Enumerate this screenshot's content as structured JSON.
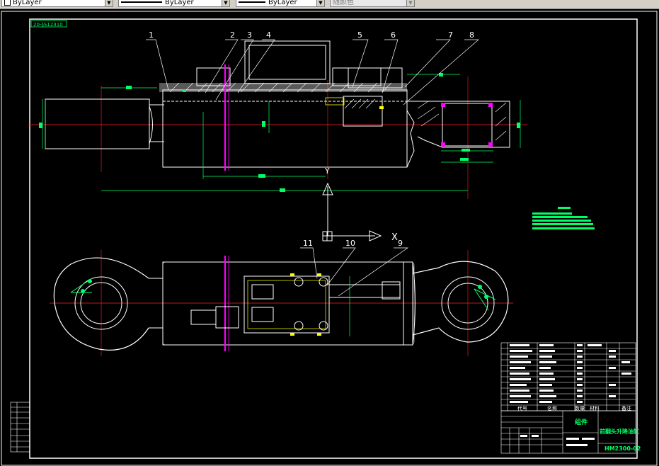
{
  "toolbar": {
    "layer_combo": "ByLayer",
    "linetype_combo": "ByLayer",
    "lineweight_combo": "ByLayer",
    "plotstyle_combo": "随颜色"
  },
  "drawing": {
    "corner_label": "20-§S12310",
    "part_numbers": [
      "1",
      "2",
      "3",
      "4",
      "5",
      "6",
      "7",
      "8",
      "9",
      "10",
      "11"
    ],
    "axis_label": "X",
    "axis_label_y": "Y",
    "title_block": {
      "col_no": "代号",
      "col_name": "名称",
      "col_qty": "数量",
      "col_material": "材料",
      "col_remark": "备注",
      "assembly": "组件",
      "drawing_name": "前翻头升降油缸",
      "drawing_number": "HM2300-02"
    }
  }
}
